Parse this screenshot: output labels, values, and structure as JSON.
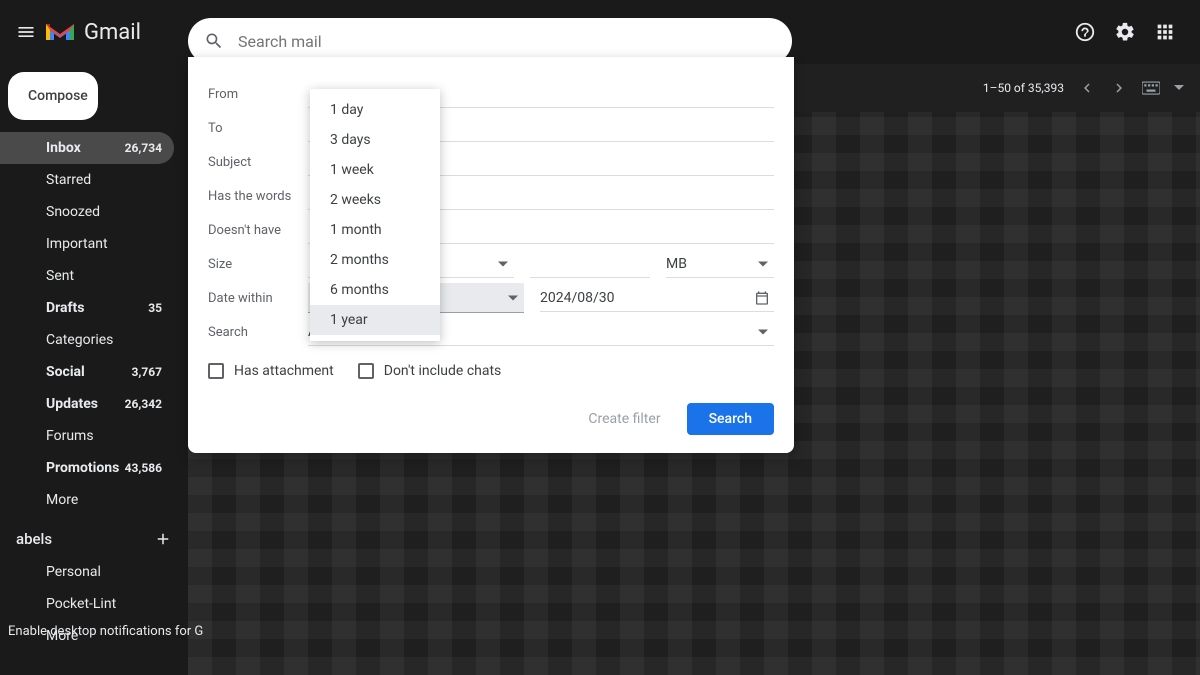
{
  "header": {
    "app_name": "Gmail",
    "search_placeholder": "Search mail"
  },
  "sidebar": {
    "compose": "Compose",
    "items": [
      {
        "label": "Inbox",
        "count": "26,734",
        "active": true,
        "bold": true
      },
      {
        "label": "Starred",
        "count": "",
        "active": false,
        "bold": false
      },
      {
        "label": "Snoozed",
        "count": "",
        "active": false,
        "bold": false
      },
      {
        "label": "Important",
        "count": "",
        "active": false,
        "bold": false
      },
      {
        "label": "Sent",
        "count": "",
        "active": false,
        "bold": false
      },
      {
        "label": "Drafts",
        "count": "35",
        "active": false,
        "bold": true
      },
      {
        "label": "Categories",
        "count": "",
        "active": false,
        "bold": false
      },
      {
        "label": "Social",
        "count": "3,767",
        "active": false,
        "bold": true
      },
      {
        "label": "Updates",
        "count": "26,342",
        "active": false,
        "bold": true
      },
      {
        "label": "Forums",
        "count": "",
        "active": false,
        "bold": false
      },
      {
        "label": "Promotions",
        "count": "43,586",
        "active": false,
        "bold": true
      },
      {
        "label": "More",
        "count": "",
        "active": false,
        "bold": false
      }
    ],
    "labels_header": "abels",
    "user_labels": [
      {
        "label": "Personal"
      },
      {
        "label": "Pocket-Lint"
      },
      {
        "label": "More"
      }
    ]
  },
  "toolbar": {
    "pagination": "1–50 of 35,393"
  },
  "search_panel": {
    "labels": {
      "from": "From",
      "to": "To",
      "subject": "Subject",
      "has_words": "Has the words",
      "doesnt_have": "Doesn't have",
      "size": "Size",
      "date_within": "Date within",
      "search": "Search"
    },
    "values": {
      "size_unit": "MB",
      "date_range_selected": "1 year",
      "date_value": "2024/08/30",
      "search_in": "All Mail"
    },
    "checkboxes": {
      "has_attachment": "Has attachment",
      "no_chats": "Don't include chats"
    },
    "buttons": {
      "create_filter": "Create filter",
      "search": "Search"
    },
    "date_options": [
      "1 day",
      "3 days",
      "1 week",
      "2 weeks",
      "1 month",
      "2 months",
      "6 months",
      "1 year"
    ]
  },
  "notification": "Enable desktop notifications for G"
}
